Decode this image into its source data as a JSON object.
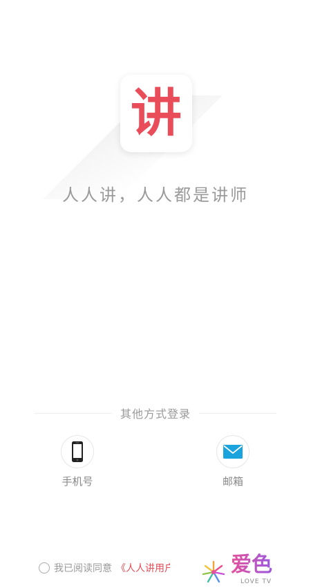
{
  "app": {
    "icon_glyph": "讲",
    "slogan": "人人讲，人人都是讲师"
  },
  "login": {
    "other_methods_label": "其他方式登录",
    "options": [
      {
        "label": "手机号",
        "icon": "phone-icon"
      },
      {
        "label": "邮箱",
        "icon": "mail-icon"
      }
    ]
  },
  "agreement": {
    "prefix": "我已阅读同意",
    "link_text": "《人人讲用户"
  },
  "watermark": {
    "title": "爱色",
    "subtitle": "LOVE TV"
  },
  "colors": {
    "brand_red": "#ea4d5a",
    "email_icon_blue": "#1aa3dd"
  }
}
